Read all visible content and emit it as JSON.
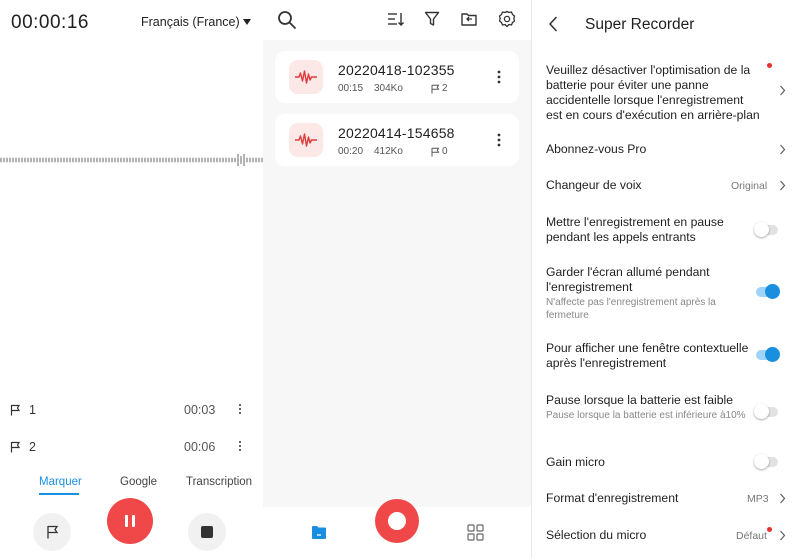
{
  "recorder": {
    "timer": "00:00:16",
    "language": "Français (France)",
    "flags": [
      {
        "num": "1",
        "time": "00:03"
      },
      {
        "num": "2",
        "time": "00:06"
      }
    ],
    "tabs": {
      "marker": "Marquer",
      "google": "Google",
      "transcription": "Transcription"
    }
  },
  "list": {
    "recordings": [
      {
        "name": "20220418-102355",
        "duration": "00:15",
        "size": "304Ko",
        "flags": "2"
      },
      {
        "name": "20220414-154658",
        "duration": "00:20",
        "size": "412Ko",
        "flags": "0"
      }
    ]
  },
  "settings": {
    "title": "Super Recorder",
    "battery_opt": "Veuillez désactiver l'optimisation de la batterie pour éviter une panne accidentelle lorsque l'enregistrement est en cours d'exécution en arrière-plan",
    "subscribe": "Abonnez-vous Pro",
    "voice_changer": "Changeur de voix",
    "voice_changer_value": "Original",
    "pause_calls": "Mettre l'enregistrement en pause pendant les appels entrants",
    "pause_calls_on": false,
    "keep_screen": "Garder l'écran allumé pendant l'enregistrement",
    "keep_screen_sub": "N'affecte pas l'enregistrement après la fermeture",
    "keep_screen_on": true,
    "popup": "Pour afficher une fenêtre contextuelle après l'enregistrement",
    "popup_on": true,
    "low_battery": "Pause lorsque la batterie est faible",
    "low_battery_sub": "Pause lorsque la batterie est inférieure à10%",
    "low_battery_on": false,
    "mic_gain": "Gain micro",
    "mic_gain_on": false,
    "format": "Format d'enregistrement",
    "format_value": "MP3",
    "mic_select": "Sélection du micro",
    "mic_select_value": "Défaut"
  },
  "colors": {
    "accent": "#1a8fe0",
    "record": "#f04848",
    "alert": "#e8312f"
  }
}
